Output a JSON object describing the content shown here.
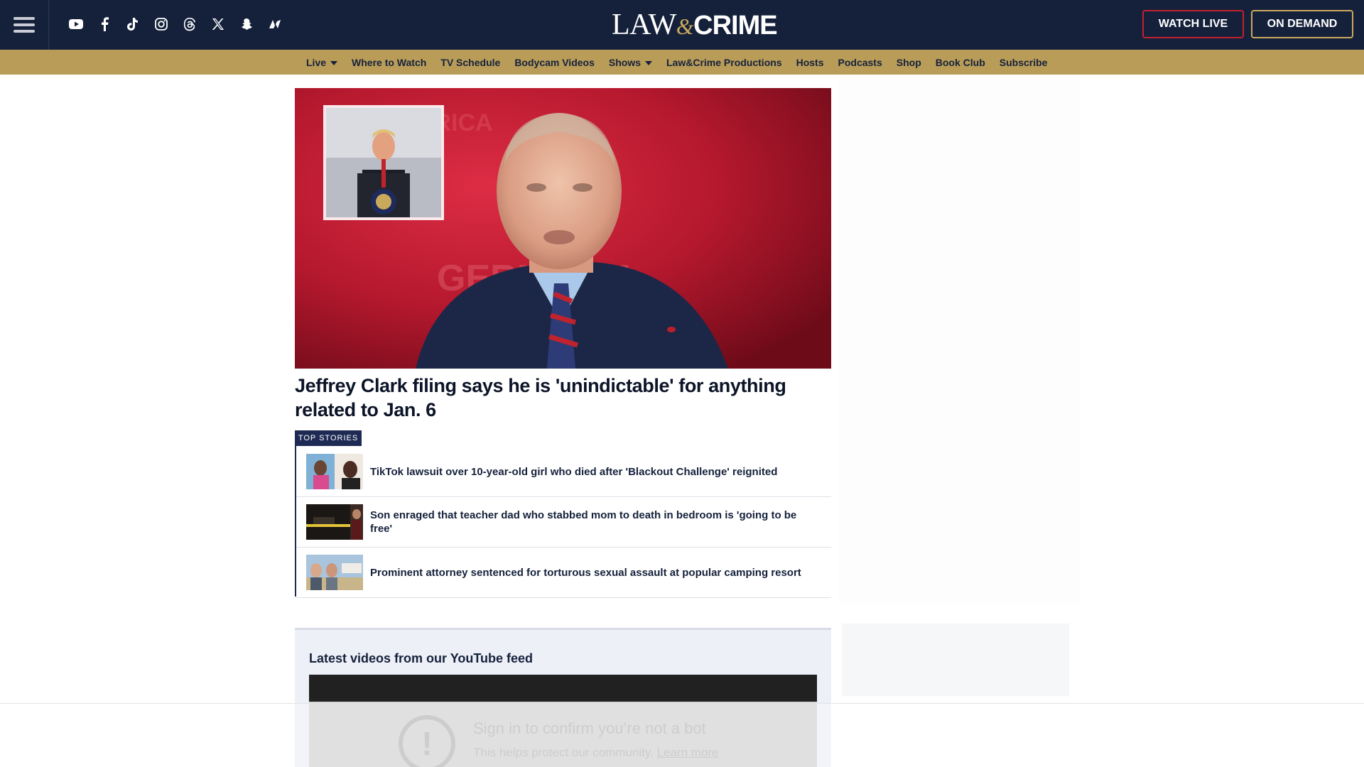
{
  "header": {
    "logo": {
      "law": "LAW",
      "amp": "&",
      "crime": "CRIME"
    },
    "socials": [
      "youtube-icon",
      "facebook-icon",
      "tiktok-icon",
      "instagram-icon",
      "threads-icon",
      "x-icon",
      "snapchat-icon",
      "news-icon"
    ],
    "watch_live": "WATCH LIVE",
    "on_demand": "ON DEMAND"
  },
  "nav": {
    "items": [
      {
        "label": "Live",
        "dropdown": true
      },
      {
        "label": "Where to Watch",
        "dropdown": false
      },
      {
        "label": "TV Schedule",
        "dropdown": false
      },
      {
        "label": "Bodycam Videos",
        "dropdown": false
      },
      {
        "label": "Shows",
        "dropdown": true
      },
      {
        "label": "Law&Crime Productions",
        "dropdown": false
      },
      {
        "label": "Hosts",
        "dropdown": false
      },
      {
        "label": "Podcasts",
        "dropdown": false
      },
      {
        "label": "Shop",
        "dropdown": false
      },
      {
        "label": "Book Club",
        "dropdown": false
      },
      {
        "label": "Subscribe",
        "dropdown": false
      }
    ]
  },
  "hero": {
    "title": "Jeffrey Clark filing says he is 'unindictable' for anything related to Jan. 6"
  },
  "top_stories": {
    "tag": "TOP STORIES",
    "items": [
      {
        "title": "TikTok lawsuit over 10-year-old girl who died after 'Blackout Challenge' reignited"
      },
      {
        "title": "Son enraged that teacher dad who stabbed mom to death in bedroom is 'going to be free'"
      },
      {
        "title": "Prominent attorney sentenced for torturous sexual assault at popular camping resort"
      }
    ]
  },
  "youtube": {
    "heading": "Latest videos from our YouTube feed",
    "notice_title": "Sign in to confirm you’re not a bot",
    "notice_text": "This helps protect our community.",
    "learn_more": "Learn more"
  },
  "colors": {
    "navy": "#15213b",
    "gold": "#b89c58",
    "live_red": "#c4202c"
  }
}
